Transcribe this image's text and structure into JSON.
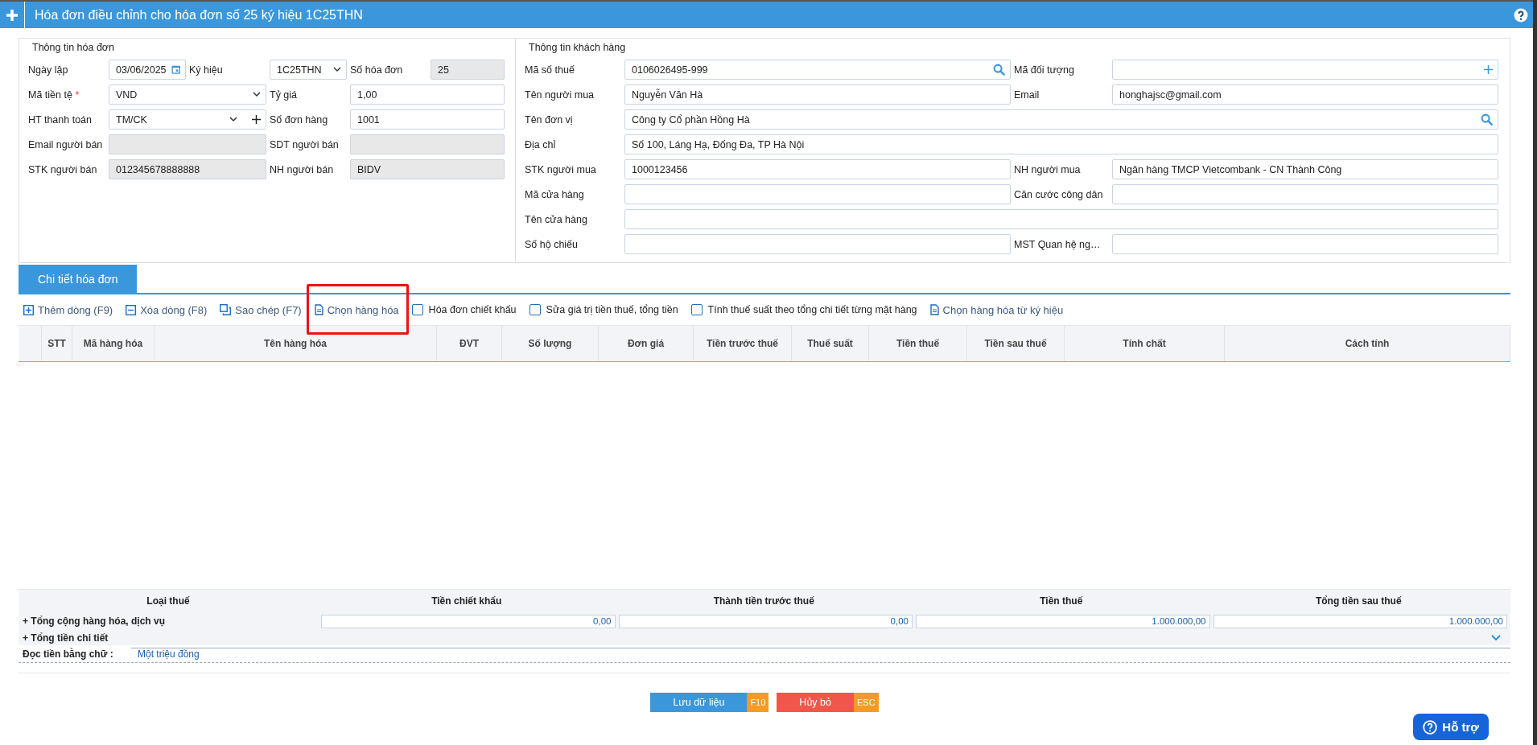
{
  "window": {
    "title": "Hóa đơn điều chỉnh cho hóa đơn số 25 ký hiệu 1C25THN"
  },
  "invoice_info": {
    "title": "Thông tin hóa đơn",
    "rows": [
      [
        {
          "label": "Ngày lập",
          "value": "03/06/2025",
          "kind": "date"
        },
        {
          "label": "Ký hiệu",
          "value": "1C25THN",
          "kind": "select"
        },
        {
          "label": "Số hóa đơn",
          "value": "25",
          "kind": "readonly"
        }
      ],
      [
        {
          "label": "Mã tiền tệ",
          "required_mark": "*",
          "value": "VND",
          "kind": "select"
        },
        {
          "label": "Tỷ giá",
          "value": "1,00",
          "kind": "text"
        }
      ],
      [
        {
          "label": "HT thanh toán",
          "value": "TM/CK",
          "kind": "select_add"
        },
        {
          "label": "Số đơn hàng",
          "value": "1001",
          "kind": "text"
        }
      ],
      [
        {
          "label": "Email người bán",
          "kind": "readonly"
        },
        {
          "label": "SDT người bán",
          "kind": "readonly"
        }
      ],
      [
        {
          "label": "STK người bán",
          "value": "012345678888888",
          "kind": "readonly"
        },
        {
          "label": "NH người bán",
          "value": "BIDV",
          "kind": "readonly"
        }
      ]
    ]
  },
  "customer_info": {
    "title": "Thông tin khách hàng",
    "rows": [
      [
        {
          "label": "Mã số thuế",
          "value": "0106026495-999",
          "kind": "search"
        },
        {
          "label": "Mã đối tượng",
          "kind": "add"
        }
      ],
      [
        {
          "label": "Tên người mua",
          "value": "Nguyễn Văn Hà",
          "kind": "text"
        },
        {
          "label": "Email",
          "value": "honghajsc@gmail.com",
          "kind": "text"
        }
      ],
      [
        {
          "label": "Tên đơn vị",
          "value": "Công ty Cổ phần Hồng Hà",
          "kind": "search"
        }
      ],
      [
        {
          "label": "Địa chỉ",
          "value": "Số 100, Láng Hạ, Đống Đa, TP Hà Nội",
          "kind": "text"
        }
      ],
      [
        {
          "label": "STK người mua",
          "value": "1000123456",
          "kind": "text"
        },
        {
          "label": "NH người mua",
          "value": "Ngân hàng TMCP Vietcombank - CN Thành Công",
          "kind": "text"
        }
      ],
      [
        {
          "label": "Mã cửa hàng",
          "kind": "text"
        },
        {
          "label": "Căn cước công dân",
          "kind": "text"
        }
      ],
      [
        {
          "label": "Tên cửa hàng",
          "kind": "text"
        }
      ],
      [
        {
          "label": "Số hộ chiếu",
          "kind": "text"
        },
        {
          "label": "MST Quan hệ ng…",
          "kind": "text"
        }
      ]
    ]
  },
  "tabs": [
    {
      "label": "Chi tiết hóa đơn",
      "selected": true
    }
  ],
  "toolbar": [
    {
      "kind": "action",
      "label": "Thêm dòng (F9)",
      "highlighted": false
    },
    {
      "kind": "action",
      "label": "Xóa dòng (F8)",
      "highlighted": false
    },
    {
      "kind": "action",
      "label": "Sao chép (F7)",
      "highlighted": false
    },
    {
      "kind": "action",
      "label": "Chọn hàng hóa",
      "highlighted": true
    },
    {
      "kind": "checkbox",
      "label": "Hóa đơn chiết khấu",
      "checked": false
    },
    {
      "kind": "checkbox",
      "label": "Sửa giá trị tiền thuế, tổng tiền",
      "checked": false
    },
    {
      "kind": "checkbox",
      "label": "Tính thuế suất theo tổng chi tiết từng mặt hàng",
      "checked": false
    },
    {
      "kind": "action",
      "label": "Chọn hàng hóa từ ký hiệu",
      "highlighted": false
    }
  ],
  "table": {
    "columns": [
      "STT",
      "Mã hàng hóa",
      "Tên hàng hóa",
      "ĐVT",
      "Số lượng",
      "Đơn giá",
      "Tiền trước thuế",
      "Thuế suất",
      "Tiền thuế",
      "Tiền sau thuế",
      "Tính chất",
      "Cách tính"
    ]
  },
  "summary": {
    "columns": [
      "Loại thuế",
      "Tiền chiết khấu",
      "Thành tiền trước thuế",
      "Tiền thuế",
      "Tổng tiền sau thuế"
    ],
    "rows": [
      {
        "label": "+ Tổng cộng hàng hóa, dịch vụ",
        "values": [
          "0,00",
          "0,00",
          "1.000.000,00",
          "1.000.000,00"
        ]
      },
      {
        "label": "+ Tổng tiền chi tiết",
        "expandable": true
      }
    ],
    "in_words": {
      "label": "Đọc tiền bằng chữ :",
      "value": "Một triệu đồng"
    }
  },
  "buttons": [
    {
      "kind": "primary",
      "label": "Lưu dữ liệu",
      "shortcut": "F10"
    },
    {
      "kind": "danger",
      "label": "Hủy bỏ",
      "shortcut": "ESC"
    }
  ],
  "help_button": {
    "label": "Hỗ trợ"
  }
}
